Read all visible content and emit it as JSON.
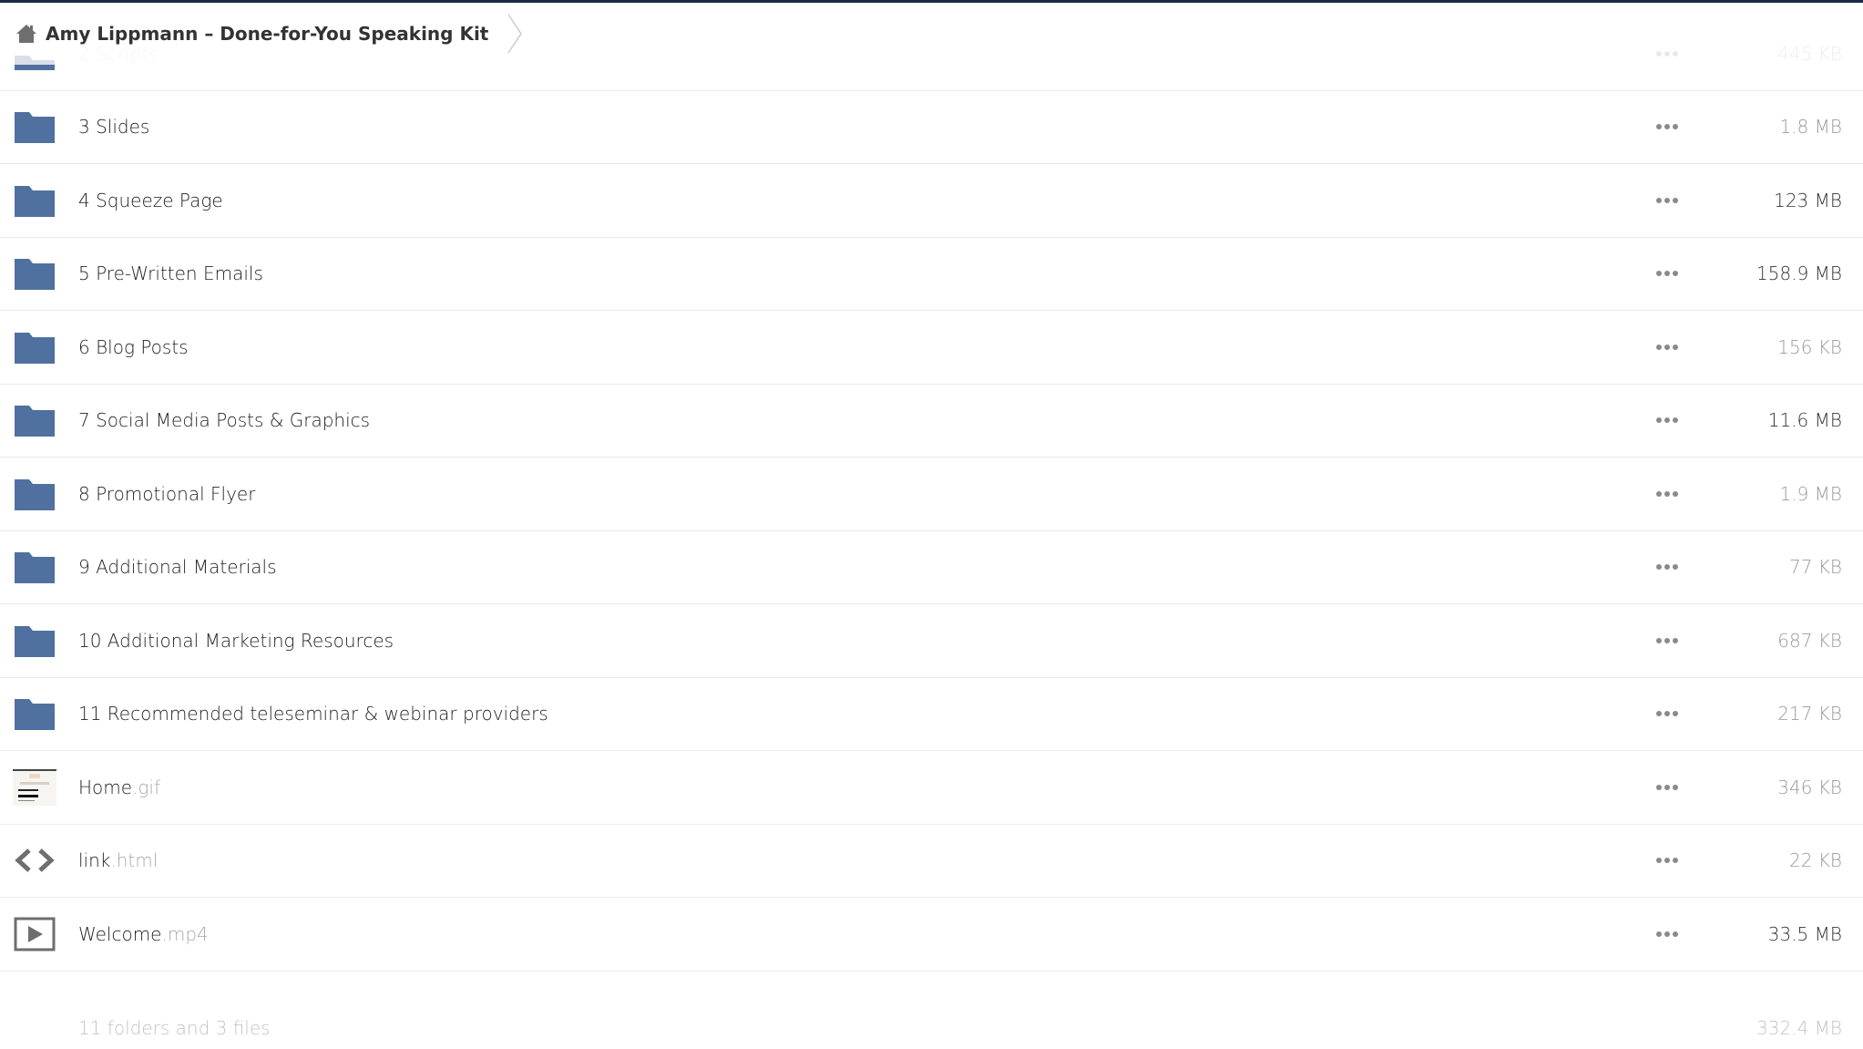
{
  "breadcrumb": {
    "home_icon": "home-icon",
    "current_folder": "Amy Lippmann – Done-for-You Speaking Kit"
  },
  "colors": {
    "folder_icon": "#50709f",
    "text": "#222222",
    "extension": "#aaaaaa",
    "size_dark": "#333333",
    "size_light": "#9a9a9a",
    "summary": "#c3c3c3",
    "divider": "#ebebeb"
  },
  "files": [
    {
      "name": "2 Scripts",
      "ext": "",
      "type": "folder",
      "size": "445 KB",
      "size_tone": "light",
      "partial": true
    },
    {
      "name": "3 Slides",
      "ext": "",
      "type": "folder",
      "size": "1.8 MB",
      "size_tone": "light"
    },
    {
      "name": "4 Squeeze Page",
      "ext": "",
      "type": "folder",
      "size": "123 MB",
      "size_tone": "dark"
    },
    {
      "name": "5 Pre-Written Emails",
      "ext": "",
      "type": "folder",
      "size": "158.9 MB",
      "size_tone": "dark"
    },
    {
      "name": "6 Blog Posts",
      "ext": "",
      "type": "folder",
      "size": "156 KB",
      "size_tone": "light"
    },
    {
      "name": "7 Social Media Posts & Graphics",
      "ext": "",
      "type": "folder",
      "size": "11.6 MB",
      "size_tone": "dark"
    },
    {
      "name": "8 Promotional Flyer",
      "ext": "",
      "type": "folder",
      "size": "1.9 MB",
      "size_tone": "light"
    },
    {
      "name": "9 Additional Materials",
      "ext": "",
      "type": "folder",
      "size": "77 KB",
      "size_tone": "light"
    },
    {
      "name": "10 Additional Marketing Resources",
      "ext": "",
      "type": "folder",
      "size": "687 KB",
      "size_tone": "light"
    },
    {
      "name": "11 Recommended teleseminar & webinar providers",
      "ext": "",
      "type": "folder",
      "size": "217 KB",
      "size_tone": "light"
    },
    {
      "name": "Home",
      "ext": ".gif",
      "type": "image",
      "size": "346 KB",
      "size_tone": "light"
    },
    {
      "name": "link",
      "ext": ".html",
      "type": "code",
      "size": "22 KB",
      "size_tone": "light"
    },
    {
      "name": "Welcome",
      "ext": ".mp4",
      "type": "video",
      "size": "33.5 MB",
      "size_tone": "dark"
    }
  ],
  "summary": {
    "label": "11 folders and 3 files",
    "total": "332.4 MB"
  }
}
